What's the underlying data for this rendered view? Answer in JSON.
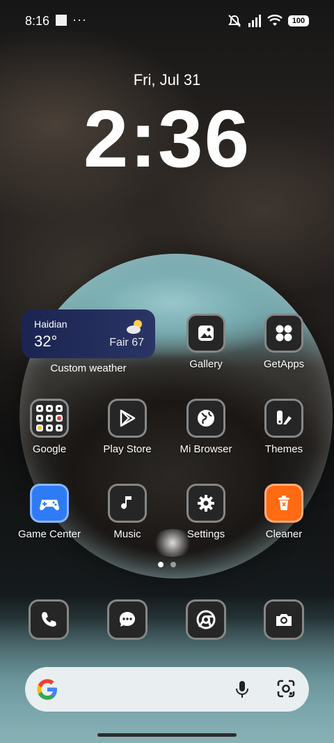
{
  "status_bar": {
    "time": "8:16",
    "more": "···",
    "battery": "100"
  },
  "lock_clock": {
    "date": "Fri, Jul 31",
    "time": "2:36"
  },
  "weather": {
    "city": "Haidian",
    "temp": "32°",
    "condition": "Fair 67",
    "label": "Custom weather"
  },
  "apps": {
    "gallery": "Gallery",
    "getapps": "GetApps",
    "google": "Google",
    "playstore": "Play Store",
    "browser": "Mi Browser",
    "themes": "Themes",
    "gamecenter": "Game Center",
    "music": "Music",
    "settings": "Settings",
    "cleaner": "Cleaner"
  },
  "colors": {
    "accent_blue": "#2f7bf5",
    "cleaner_orange": "#ff6a13",
    "widget_bg": "#1b2450"
  }
}
